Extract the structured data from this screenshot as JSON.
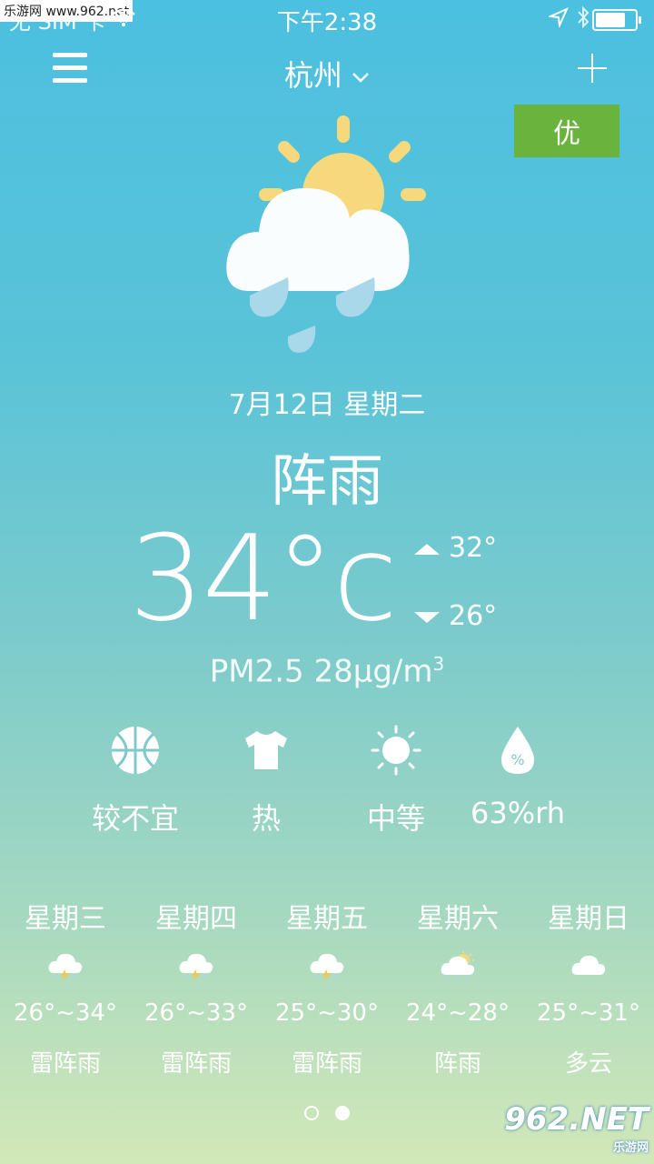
{
  "status_bar": {
    "carrier": "无 SIM 卡",
    "time": "下午2:38",
    "watermark": "乐游网 www.962.net",
    "battery_level": 0.85
  },
  "header": {
    "city": "杭州",
    "aqi_badge": "优",
    "aqi_color": "#6ab43d"
  },
  "today": {
    "date": "7月12日 星期二",
    "condition": "阵雨",
    "temperature": "34°c",
    "high": "32°",
    "low": "26°",
    "pm25": "PM2.5  28μg/m",
    "pm25_sup": "3",
    "icon": "sun-cloud-rain-icon"
  },
  "indicators": [
    {
      "icon": "basketball-icon",
      "label": "较不宜"
    },
    {
      "icon": "tshirt-icon",
      "label": "热"
    },
    {
      "icon": "sun-icon",
      "label": "中等"
    },
    {
      "icon": "humidity-drop-icon",
      "label": "63%rh"
    }
  ],
  "forecast": [
    {
      "day": "星期三",
      "icon": "thunderstorm-icon",
      "range": "26°~34°",
      "weather": "雷阵雨"
    },
    {
      "day": "星期四",
      "icon": "thunderstorm-icon",
      "range": "26°~33°",
      "weather": "雷阵雨"
    },
    {
      "day": "星期五",
      "icon": "thunderstorm-icon",
      "range": "25°~30°",
      "weather": "雷阵雨"
    },
    {
      "day": "星期六",
      "icon": "sun-cloud-rain-icon",
      "range": "24°~28°",
      "weather": "阵雨"
    },
    {
      "day": "星期日",
      "icon": "cloud-icon",
      "range": "25°~31°",
      "weather": "多云"
    }
  ],
  "pager": {
    "pages": 2,
    "current": 2
  },
  "brand": {
    "logo": "962.NET",
    "sub": "乐游网"
  }
}
